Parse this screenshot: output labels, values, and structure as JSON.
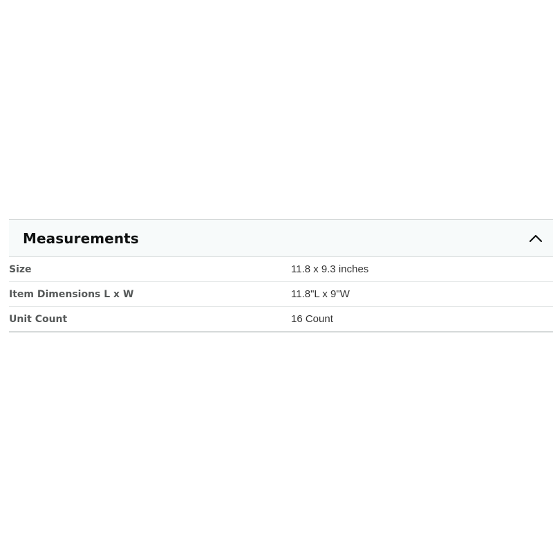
{
  "section": {
    "title": "Measurements",
    "toggle_icon": "chevron-up-icon",
    "rows": [
      {
        "label": "Size",
        "value": "11.8 x 9.3 inches"
      },
      {
        "label": "Item Dimensions L x W",
        "value": "11.8\"L x 9\"W"
      },
      {
        "label": "Unit Count",
        "value": "16 Count"
      }
    ]
  }
}
